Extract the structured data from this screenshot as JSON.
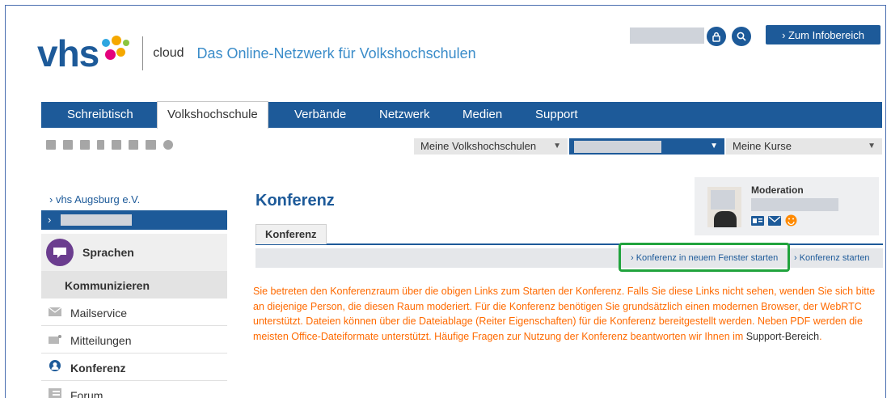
{
  "header": {
    "logo_text": "vhs",
    "cloud_label": "cloud",
    "tagline": "Das Online-Netzwerk für Volkshochschulen",
    "info_button": "› Zum Infobereich",
    "lock_icon": "lock-icon",
    "search_icon": "search-icon"
  },
  "nav": {
    "items": [
      "Schreibtisch",
      "Volkshochschule",
      "Verbände",
      "Netzwerk",
      "Medien",
      "Support"
    ],
    "active": "Volkshochschule"
  },
  "toolbar": {
    "icons": [
      "tree-icon",
      "list-icon",
      "hierarchy-icon",
      "bookmark-icon",
      "export-icon",
      "pdf-icon",
      "print-icon",
      "help-icon"
    ],
    "select_vhs": "Meine Volkshochschulen",
    "select_kurse": "Meine Kurse"
  },
  "sidebar": {
    "parent_link": "› vhs Augsburg e.V.",
    "active_marker": "›",
    "group_label": "Sprachen",
    "section_heading": "Kommunizieren",
    "items": [
      {
        "label": "Mailservice",
        "icon": "mail-icon"
      },
      {
        "label": "Mitteilungen",
        "icon": "message-icon"
      },
      {
        "label": "Konferenz",
        "icon": "conference-icon"
      },
      {
        "label": "Forum",
        "icon": "forum-icon"
      }
    ]
  },
  "main": {
    "title": "Konferenz",
    "tab": "Konferenz",
    "action_new_window": "› Konferenz in neuem Fenster starten",
    "action_start": "› Konferenz starten",
    "body_orange": "Sie betreten den Konferenzraum über die obigen Links zum Starten der Konferenz. Falls Sie diese Links nicht sehen, wenden Sie sich bitte an diejenige Person, die diesen Raum moderiert. Für die Konferenz benötigen Sie grundsätzlich einen modernen Browser, der WebRTC unterstützt. Dateien können über die Dateiablage (Reiter Eigenschaften) für die Konferenz bereitgestellt werden. Neben PDF werden die meisten Office-Dateiformate unterstützt. Häufige Fragen zur Nutzung der Konferenz beantworten wir Ihnen im ",
    "body_link": "Support-Bereich",
    "body_end": "."
  },
  "moderation": {
    "title": "Moderation",
    "icons": [
      "vcard-icon",
      "envelope-icon",
      "smiley-icon"
    ]
  },
  "colors": {
    "brand_blue": "#1d5a99",
    "accent_orange": "#ff6a00",
    "highlight_green": "#21a33d"
  }
}
